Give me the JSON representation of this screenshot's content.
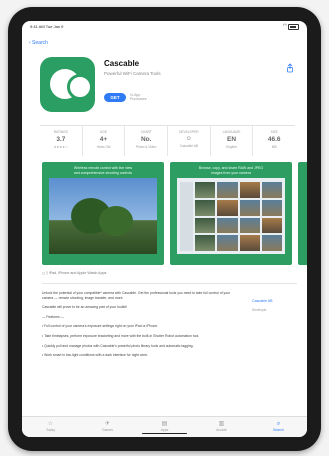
{
  "statusbar": {
    "time": "9:41 AM  Tue Jan 9"
  },
  "nav": {
    "back_label": "‹ Search"
  },
  "app": {
    "title": "Cascable",
    "subtitle": "Powerful WiFi Camera Tools",
    "get_label": "GET",
    "iap_note": "In-App\nPurchases"
  },
  "stats": [
    {
      "label": "RATINGS",
      "value": "3.7",
      "sub": "★★★★☆"
    },
    {
      "label": "AGE",
      "value": "4+",
      "sub": "Years Old"
    },
    {
      "label": "CHART",
      "value": "No.",
      "sub": "Photo & Video"
    },
    {
      "label": "DEVELOPER",
      "value": "☺",
      "sub": "Cascable AB"
    },
    {
      "label": "LANGUAGE",
      "value": "EN",
      "sub": "English"
    },
    {
      "label": "SIZE",
      "value": "46.6",
      "sub": "MB"
    }
  ],
  "screenshots": [
    {
      "caption": "Wireless remote control with live view\nand comprehensive shooting controls"
    },
    {
      "caption": "Browse, copy, and share RAW and JPEG\nimages from your camera"
    }
  ],
  "compat_note": "◻ ▯  iPad, iPhone and Apple Watch Apps",
  "description": [
    "Unlock the potential of your compatible* camera with Cascable. Get the professional tools you need to take full control of your camera — remote shooting, image transfer, and more.",
    "Cascable will prove to be an amazing part of your toolkit!",
    "— Features —",
    "• Full control of your camera's exposure settings right on your iPad or iPhone.",
    "• Take timelapses, perform exposure bracketing and more with the built-in Shutter Robot automation tool.",
    "• Quickly pull and manage photos with Cascable's powerful photo library tools and automatic tagging.",
    "• Work smart in low-light conditions with a dark interface for night work."
  ],
  "developer": {
    "link": "Cascable AB",
    "sub": "Developer"
  },
  "tabs": [
    {
      "icon": "☆",
      "label": "Today"
    },
    {
      "icon": "✈",
      "label": "Games"
    },
    {
      "icon": "▤",
      "label": "Apps"
    },
    {
      "icon": "▥",
      "label": "Arcade"
    },
    {
      "icon": "⌕",
      "label": "Search"
    }
  ],
  "colors": {
    "accent": "#2f7bf5",
    "brand_green": "#2a9e63"
  }
}
